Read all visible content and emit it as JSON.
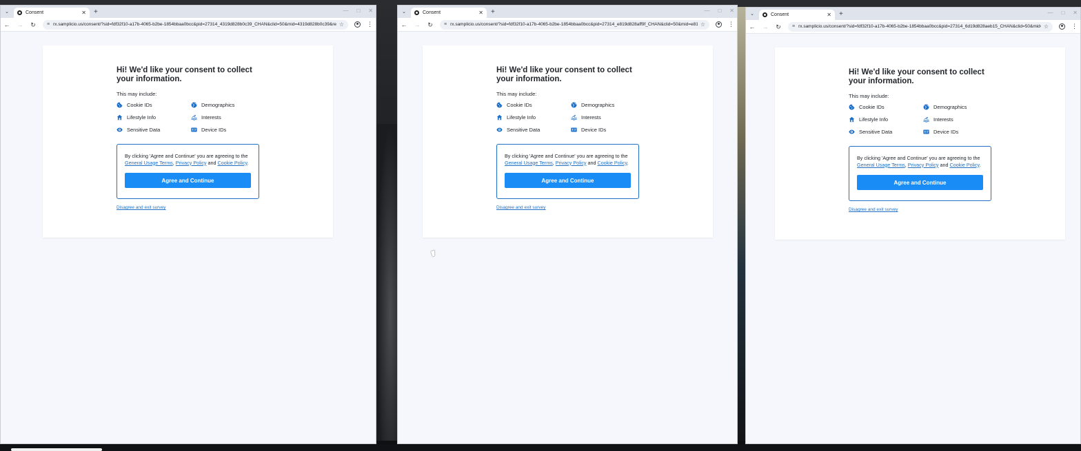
{
  "windows": [
    {
      "tab": {
        "title": "Consent"
      },
      "address": {
        "url": "rx.samplicio.us/consent/?sid=fdf32f10-a17b-4065-b2be-1854bbaa0bcc&pid=27314_4319d828b0c39_CHAN&clid=50&mid=4319d828b0c39&re..."
      },
      "consent": {
        "heading": "Hi! We'd like your consent to collect your information.",
        "may_include": "This may include:",
        "items": [
          "Cookie IDs",
          "Demographics",
          "Lifestyle Info",
          "Interests",
          "Sensitive Data",
          "Device IDs"
        ],
        "agree_prefix": "By clicking 'Agree and Continue' you are agreeing to the",
        "link_terms": "General Usage Terms",
        "sep": ",",
        "link_privacy": "Privacy Policy",
        "and": "and",
        "link_cookie": "Cookie Policy",
        "end": ".",
        "agree_button": "Agree and Continue",
        "disagree_link": "Disagree and exit survey"
      }
    },
    {
      "tab": {
        "title": "Consent"
      },
      "address": {
        "url": "rx.samplicio.us/consent/?sid=fdf32f10-a17b-4065-b2be-1854bbaa0bcc&pid=27314_e819d828aff9f_CHAN&clid=50&mid=e81..."
      },
      "consent": {
        "heading": "Hi! We'd like your consent to collect your information.",
        "may_include": "This may include:",
        "items": [
          "Cookie IDs",
          "Demographics",
          "Lifestyle Info",
          "Interests",
          "Sensitive Data",
          "Device IDs"
        ],
        "agree_prefix": "By clicking 'Agree and Continue' you are agreeing to the",
        "link_terms": "General Usage Terms",
        "sep": ",",
        "link_privacy": "Privacy Policy",
        "and": "and",
        "link_cookie": "Cookie Policy",
        "end": ".",
        "agree_button": "Agree and Continue",
        "disagree_link": "Disagree and exit survey"
      }
    },
    {
      "tab": {
        "title": "Consent"
      },
      "address": {
        "url": "rx.samplicio.us/consent/?sid=fdf32f10-a17b-4065-b2be-1854bbaa0bcc&pid=27314_6d19d828aeb15_CHAN&clid=50&mid=6d19..."
      },
      "consent": {
        "heading": "Hi! We'd like your consent to collect your information.",
        "may_include": "This may include:",
        "items": [
          "Cookie IDs",
          "Demographics",
          "Lifestyle Info",
          "Interests",
          "Sensitive Data",
          "Device IDs"
        ],
        "agree_prefix": "By clicking 'Agree and Continue' you are agreeing to the",
        "link_terms": "General Usage Terms",
        "sep": ",",
        "link_privacy": "Privacy Policy",
        "and": "and",
        "link_cookie": "Cookie Policy",
        "end": ".",
        "agree_button": "Agree and Continue",
        "disagree_link": "Disagree and exit survey"
      }
    }
  ],
  "icons": [
    "cookie-icon",
    "globe-icon",
    "home-icon",
    "waves-icon",
    "eye-icon",
    "id-card-icon"
  ],
  "colors": {
    "accent": "#1a8cf5",
    "link": "#1f6fc4",
    "icon": "#1b6fc8",
    "page_bg": "#f5f7fc"
  }
}
